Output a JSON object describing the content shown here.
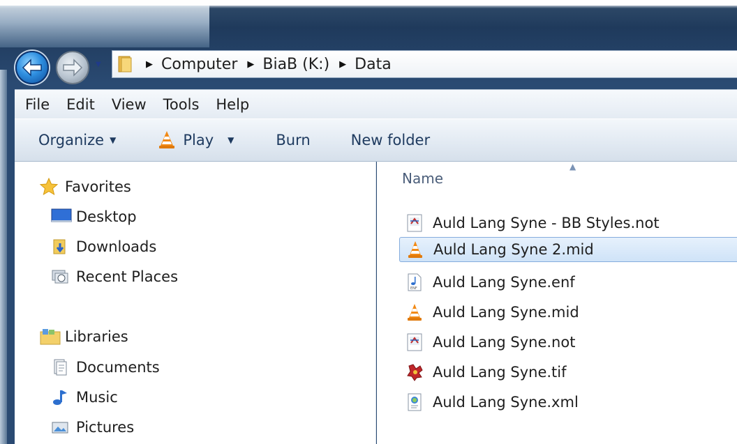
{
  "address": {
    "crumbs": [
      "Computer",
      "BiaB (K:)",
      "Data"
    ]
  },
  "menu": [
    "File",
    "Edit",
    "View",
    "Tools",
    "Help"
  ],
  "toolbar": {
    "organize": "Organize",
    "play": "Play",
    "burn": "Burn",
    "new_folder": "New folder"
  },
  "nav": {
    "favorites": "Favorites",
    "desktop": "Desktop",
    "downloads": "Downloads",
    "recent_places": "Recent Places",
    "libraries": "Libraries",
    "documents": "Documents",
    "music": "Music",
    "pictures": "Pictures"
  },
  "content": {
    "column_name": "Name",
    "files": [
      {
        "name": "Auld Lang Syne - BB Styles.not",
        "icon": "notation-file-icon"
      },
      {
        "name": "Auld Lang Syne 2.mid",
        "icon": "vlc-cone-icon",
        "selected": true
      },
      {
        "name": "Auld Lang Syne.enf",
        "icon": "music-note-file-icon"
      },
      {
        "name": "Auld Lang Syne.mid",
        "icon": "vlc-cone-icon"
      },
      {
        "name": "Auld Lang Syne.not",
        "icon": "notation-file-icon"
      },
      {
        "name": "Auld Lang Syne.tif",
        "icon": "image-viewer-icon"
      },
      {
        "name": "Auld Lang Syne.xml",
        "icon": "xml-document-icon"
      }
    ]
  }
}
